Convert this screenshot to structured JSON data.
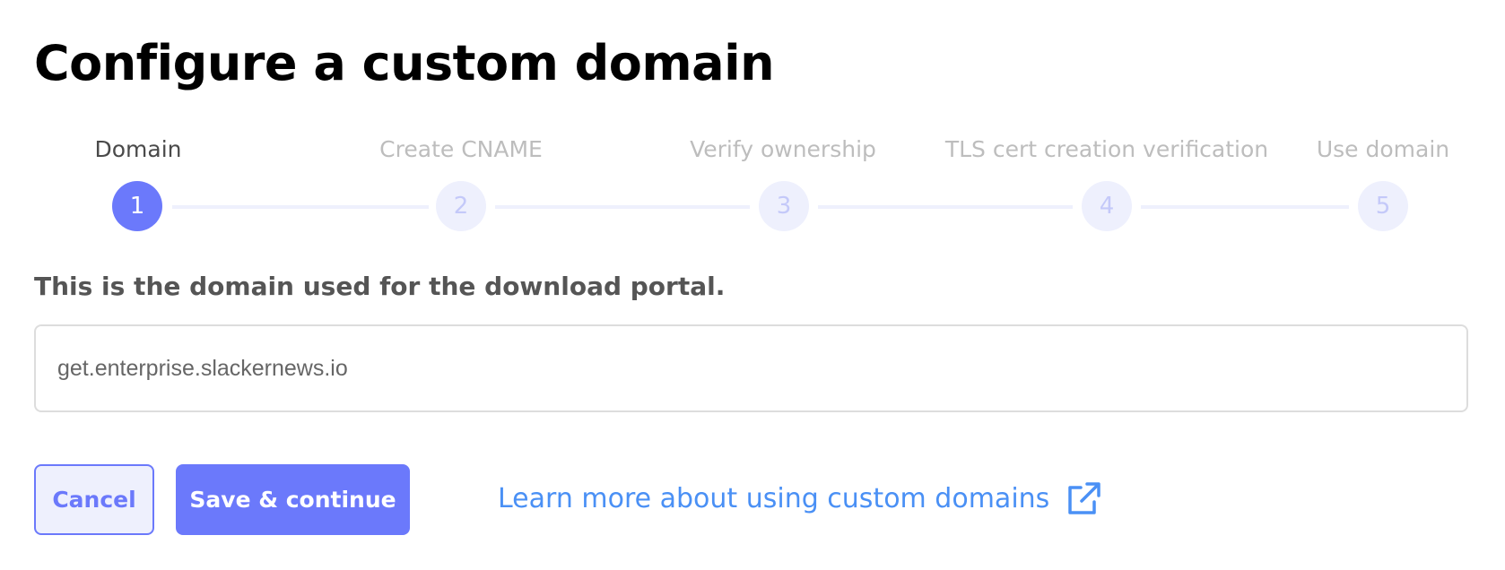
{
  "page": {
    "title": "Configure a custom domain"
  },
  "stepper": {
    "active_index": 0,
    "steps": [
      {
        "number": "1",
        "label": "Domain",
        "state": "active"
      },
      {
        "number": "2",
        "label": "Create CNAME",
        "state": "upcoming"
      },
      {
        "number": "3",
        "label": "Verify ownership",
        "state": "upcoming"
      },
      {
        "number": "4",
        "label": "TLS cert creation verification",
        "state": "upcoming"
      },
      {
        "number": "5",
        "label": "Use domain",
        "state": "upcoming"
      }
    ]
  },
  "form": {
    "label": "This is the domain used for the download portal.",
    "domain_value": "get.enterprise.slackernews.io"
  },
  "actions": {
    "cancel_label": "Cancel",
    "save_label": "Save & continue",
    "learn_more_label": "Learn more about using custom domains",
    "learn_more_icon": "external-link-icon"
  },
  "colors": {
    "accent": "#6b79fb",
    "accent_light": "#eef0fd",
    "link": "#4a90f5",
    "inactive_text": "#bdbdbd"
  }
}
